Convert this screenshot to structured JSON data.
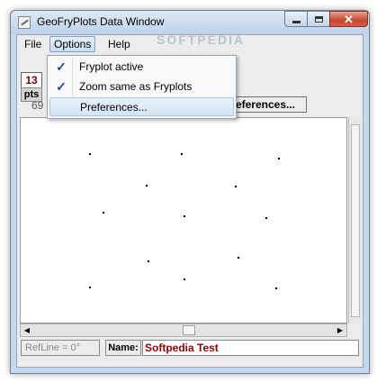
{
  "window": {
    "title": "GeoFryPlots Data Window",
    "watermark": "SOFTPEDIA"
  },
  "menubar": {
    "items": [
      "File",
      "Options",
      "Help"
    ]
  },
  "options_menu": {
    "items": [
      {
        "label": "Fryplot active",
        "checked": true,
        "check_glyph": "✓"
      },
      {
        "label": "Zoom same as Fryplots",
        "checked": true,
        "check_glyph": "✓"
      },
      {
        "label": "Preferences...",
        "checked": false,
        "check_glyph": ""
      }
    ]
  },
  "toolbar": {
    "point_count": "13",
    "pts_label": "pts",
    "partial_number": "69",
    "preferences_button": "eferences..."
  },
  "plot": {
    "points": [
      [
        0.211,
        0.173
      ],
      [
        0.491,
        0.173
      ],
      [
        0.791,
        0.192
      ],
      [
        0.385,
        0.327
      ],
      [
        0.658,
        0.332
      ],
      [
        0.25,
        0.457
      ],
      [
        0.5,
        0.475
      ],
      [
        0.75,
        0.484
      ],
      [
        0.39,
        0.698
      ],
      [
        0.665,
        0.677
      ],
      [
        0.209,
        0.825
      ],
      [
        0.5,
        0.785
      ],
      [
        0.782,
        0.827
      ]
    ]
  },
  "status": {
    "refline": "RefLine = 0°",
    "name_label": "Name:",
    "name_value": "Softpedia Test"
  },
  "colors": {
    "accent_check": "#1c4a9a",
    "count_text": "#7a0000",
    "name_text": "#8a0000"
  }
}
